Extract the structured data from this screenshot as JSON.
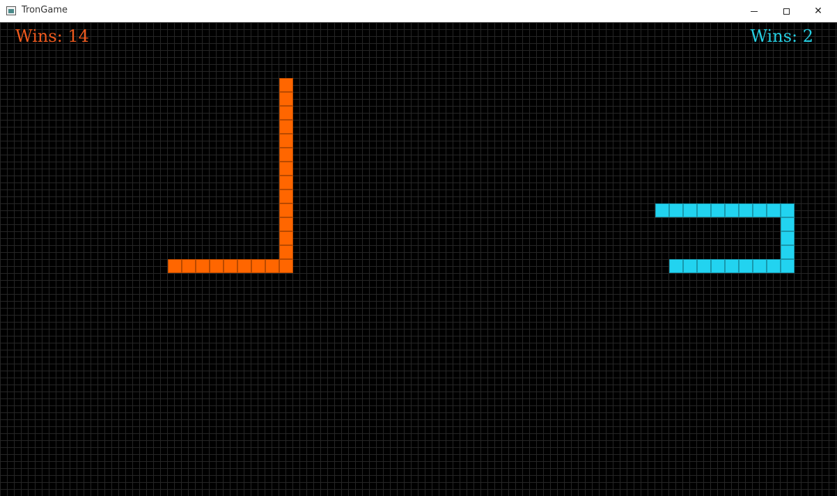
{
  "window": {
    "title": "TronGame",
    "buttons": {
      "minimize": "minimize-icon",
      "maximize": "maximize-icon",
      "close": "close-icon"
    }
  },
  "game": {
    "player1": {
      "wins_label": "Wins: 14",
      "color": "#ff6600",
      "score_color": "#f05a1e"
    },
    "player2": {
      "wins_label": "Wins: 2",
      "color": "#22d3f0",
      "score_color": "#26cfe2"
    }
  }
}
